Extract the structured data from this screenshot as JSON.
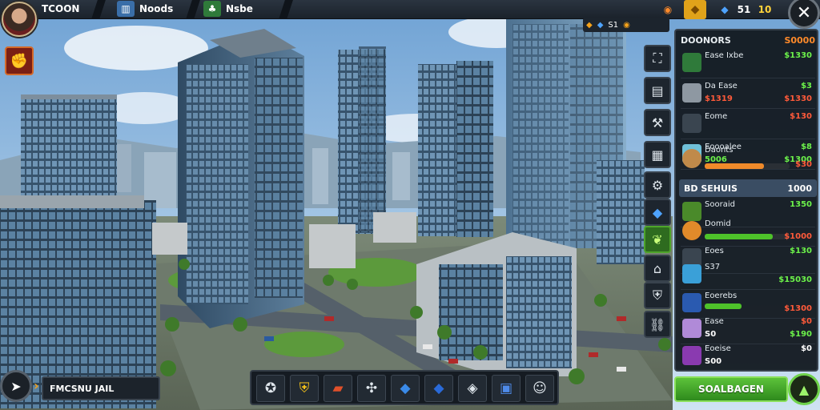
{
  "topbar": {
    "player_name": "TCOON",
    "stat_1": "Noods",
    "stat_2": "Nsbe",
    "res_a": "S1",
    "res_b": "51",
    "res_c": "10"
  },
  "resource_chip": {
    "value": "S1"
  },
  "panel": {
    "title": "DOONORS",
    "title_value": "S0000",
    "rows": [
      {
        "name": "Ease Ixbe",
        "v1": "$1330",
        "sub": "",
        "v2": ""
      },
      {
        "name": "Da Ease",
        "v1": "$3",
        "sub": "$1319",
        "v2": "$1330"
      },
      {
        "name": "Eome",
        "v1": "$130",
        "sub": "",
        "v2": ""
      },
      {
        "name": "Eoooalee",
        "v1": "$8",
        "sub": "5006",
        "v2": "$1300"
      },
      {
        "name": "Daonts",
        "v1": "",
        "sub": "",
        "v2": "$30"
      }
    ],
    "sub_header": {
      "title": "BD SEHUIS",
      "value": "1000"
    },
    "rows2": [
      {
        "name": "Sooraid",
        "v1": "1350",
        "sub": "",
        "v2": ""
      },
      {
        "name": "Domid",
        "v1": "",
        "sub": "",
        "v2": "$1000"
      },
      {
        "name": "Eoes",
        "v1": "$130",
        "sub": "",
        "v2": ""
      },
      {
        "name": "S37",
        "v1": "",
        "sub": "",
        "v2": "$15030"
      },
      {
        "name": "Eoerebs",
        "v1": "",
        "sub": "",
        "v2": "$1300"
      },
      {
        "name": "Ease",
        "v1": "$0",
        "sub": "S0",
        "v2": "$190"
      },
      {
        "name": "Eoeise",
        "v1": "$0",
        "sub": "S00",
        "v2": ""
      }
    ],
    "action_label": "SOALBAGEN"
  },
  "bottom": {
    "player_bar": "FMCSNU JAIL"
  },
  "colors": {
    "accent_green": "#6cf24a",
    "accent_orange": "#ff8a2a",
    "accent_red": "#ff5a3a",
    "panel_bg": "#12181f"
  },
  "icons": {
    "top": [
      "avatar-portrait",
      "building-icon",
      "tree-icon",
      "coin-icon",
      "gem-icon",
      "close-icon"
    ],
    "vertical_toolbar": [
      "map-icon",
      "document-icon",
      "hammer-icon",
      "factory-icon",
      "gear-icon",
      "cube-icon",
      "leaf-icon",
      "house-icon",
      "shield-icon",
      "chain-icon"
    ],
    "dock": [
      "emblem-icon",
      "shield-icon",
      "book-icon",
      "puzzle-icon",
      "cube-icon",
      "cube-icon",
      "tag-icon",
      "crate-icon",
      "smile-icon"
    ]
  }
}
